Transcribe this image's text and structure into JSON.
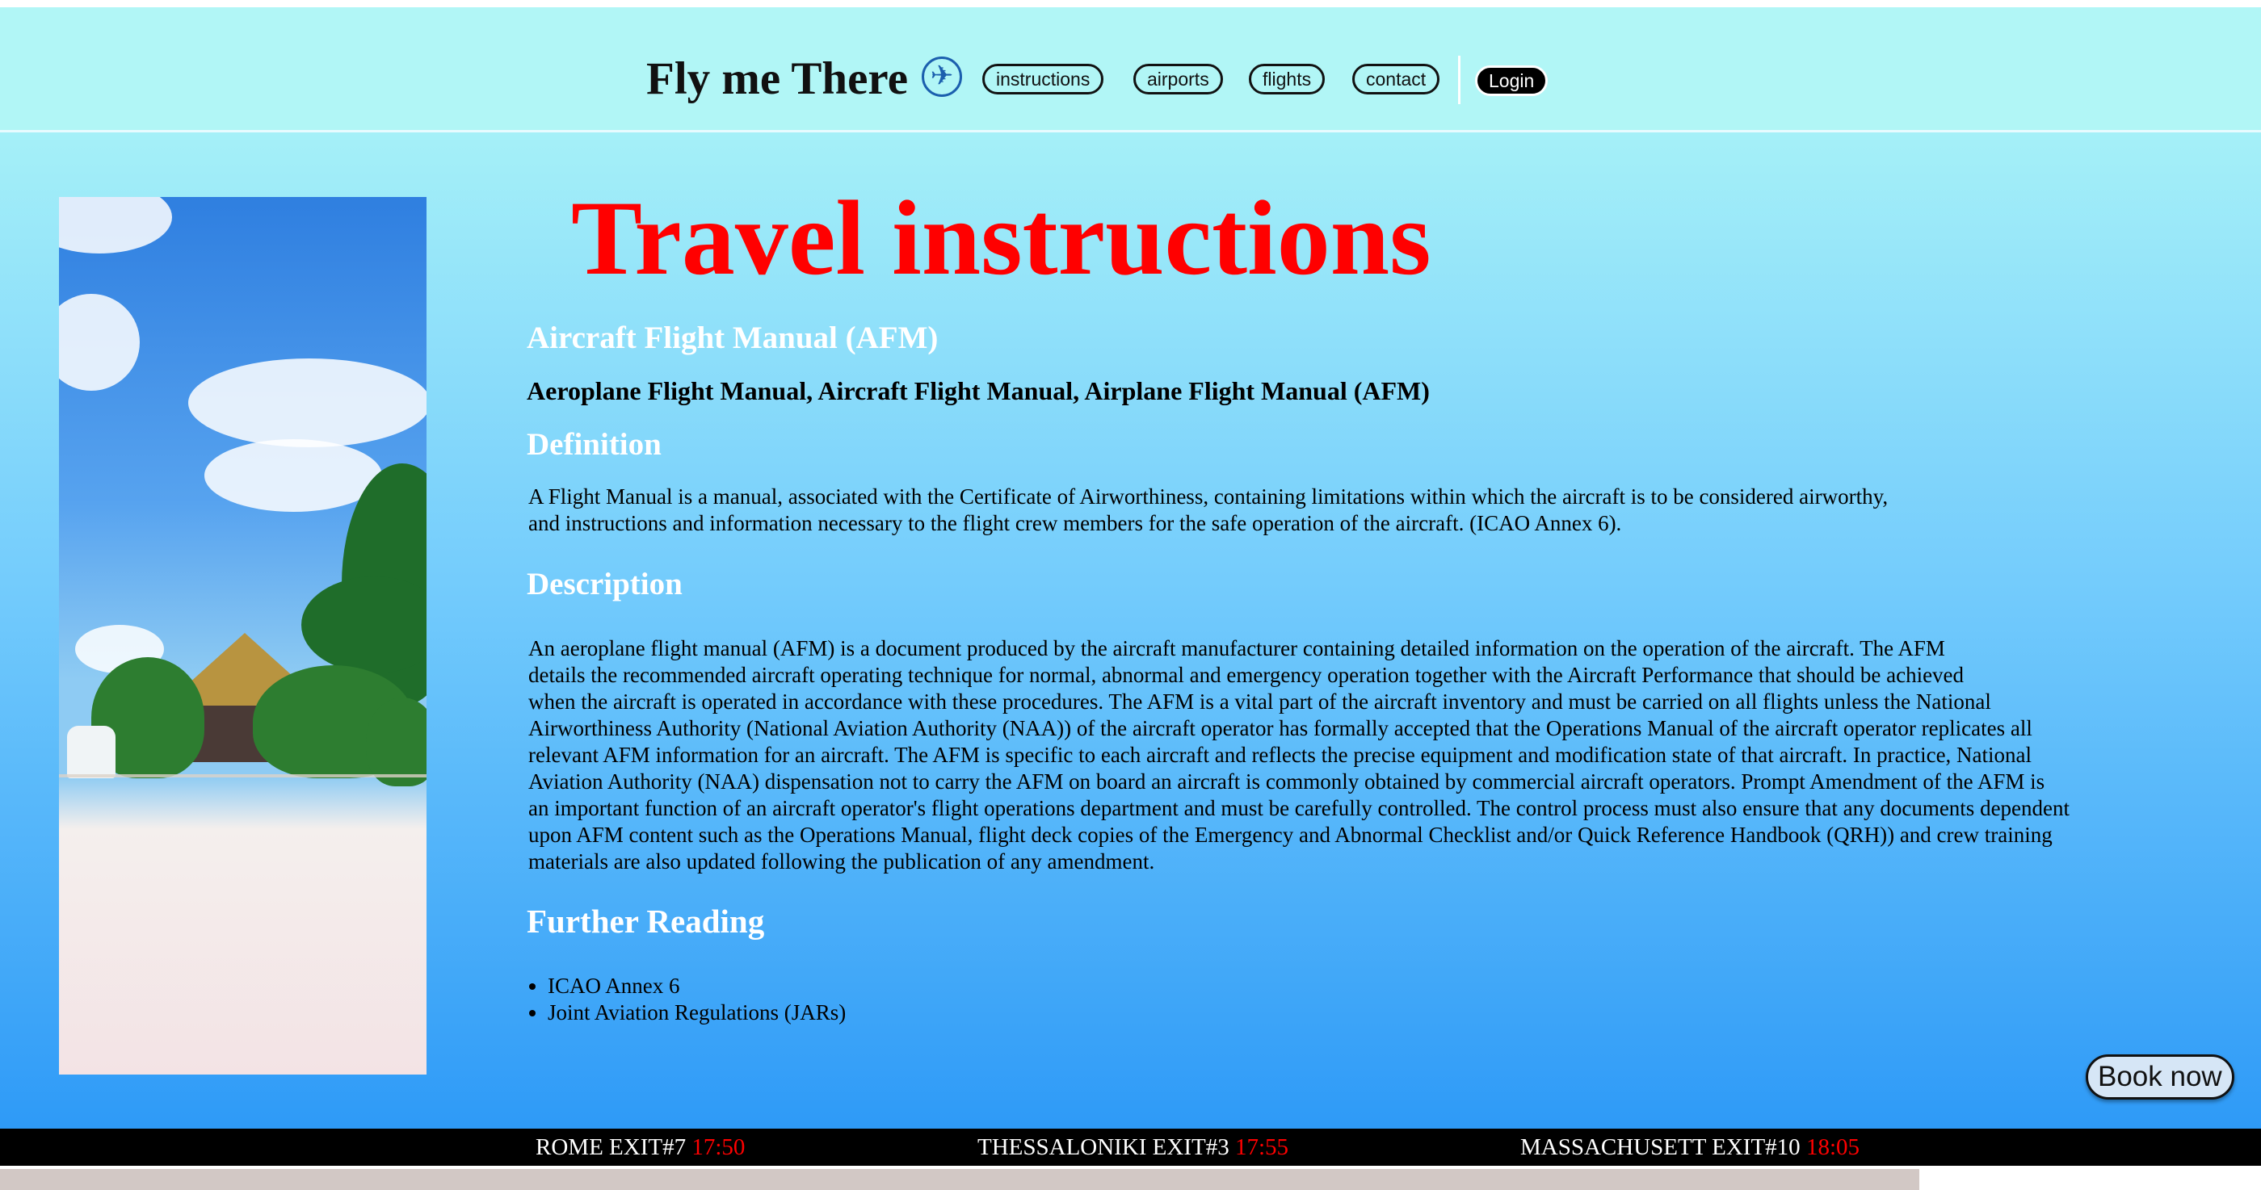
{
  "header": {
    "brand": "Fly me There",
    "nav": [
      "instructions",
      "airports",
      "flights",
      "contact"
    ],
    "login": "Login"
  },
  "page": {
    "title": "Travel instructions",
    "section_title": "Aircraft Flight Manual (AFM)",
    "subtitle": "Aeroplane Flight Manual, Aircraft Flight Manual, Airplane Flight Manual (AFM)",
    "definition_heading": "Definition",
    "definition_lines": [
      "A Flight Manual is a manual, associated with the Certificate of Airworthiness, containing limitations within which the aircraft is to be considered airworthy,",
      "and instructions and information necessary to the flight crew members for the safe operation of the aircraft. (ICAO Annex 6)."
    ],
    "description_heading": "Description",
    "description_lines": [
      "An aeroplane flight manual (AFM) is a document produced by the aircraft manufacturer containing detailed information on the operation of the aircraft. The AFM",
      "details the recommended aircraft operating technique for normal, abnormal and emergency operation together with the Aircraft Performance that should be achieved",
      "when the aircraft is operated in accordance with these procedures. The AFM is a vital part of the aircraft inventory and must be carried on all flights unless the National",
      "Airworthiness Authority (National Aviation Authority (NAA)) of the aircraft operator has formally accepted that the Operations Manual of the aircraft operator replicates all",
      "relevant AFM information for an aircraft. The AFM is specific to each aircraft and reflects the precise equipment and modification state of that aircraft. In practice, National",
      "Aviation Authority (NAA) dispensation not to carry the AFM on board an aircraft is commonly obtained by commercial aircraft operators. Prompt Amendment of the AFM is",
      "an important function of an aircraft operator's flight operations department and must be carefully controlled. The control process must also ensure that any documents dependent",
      "upon AFM content such as the Operations Manual, flight deck copies of the Emergency and Abnormal Checklist and/or Quick Reference Handbook (QRH)) and crew training",
      "materials are also updated following the publication of any amendment."
    ],
    "further_heading": "Further Reading",
    "further_items": [
      "ICAO Annex 6",
      "Joint Aviation Regulations (JARs)"
    ]
  },
  "book_now": "Book now",
  "ticker": [
    {
      "label": "ROME EXIT#7",
      "time": "17:50"
    },
    {
      "label": "THESSALONIKI EXIT#3",
      "time": "17:55"
    },
    {
      "label": "MASSACHUSETT EXIT#10",
      "time": "18:05"
    }
  ],
  "colors": {
    "title": "#ff0000",
    "header_bg": "#b1f6f6",
    "gradient_top": "#a5f0f8",
    "gradient_bottom": "#2e9af7",
    "ticker_time": "#ff0000"
  },
  "icons": {
    "brand": "airplane-icon"
  }
}
